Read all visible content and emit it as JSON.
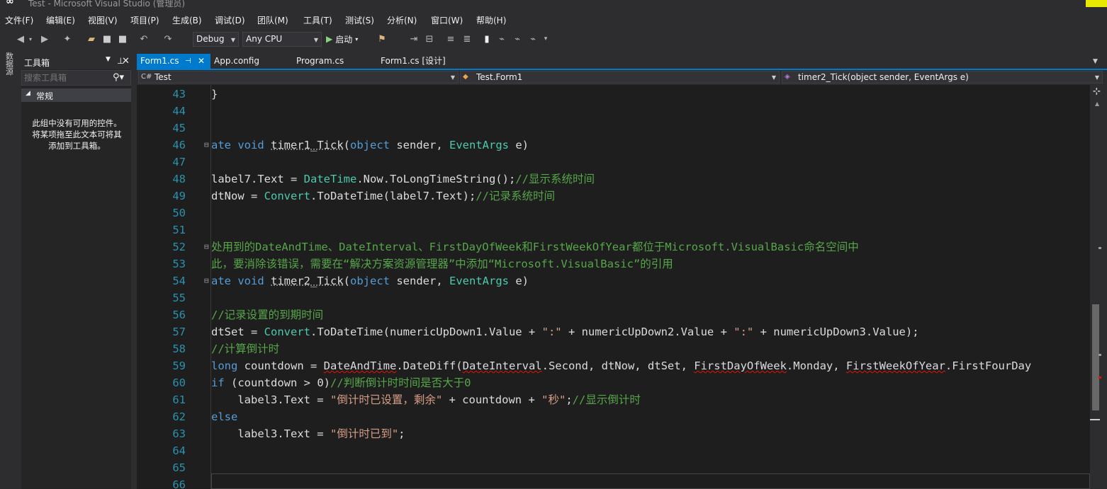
{
  "window": {
    "title": "Test - Microsoft Visual Studio (管理员)"
  },
  "menu": [
    "文件(F)",
    "编辑(E)",
    "视图(V)",
    "项目(P)",
    "生成(B)",
    "调试(D)",
    "团队(M)",
    "工具(T)",
    "测试(S)",
    "分析(N)",
    "窗口(W)",
    "帮助(H)"
  ],
  "toolbar": {
    "config": "Debug",
    "platform": "Any CPU",
    "start_label": "启动"
  },
  "left_strip": {
    "label": "数据源"
  },
  "toolbox": {
    "title": "工具箱",
    "search_placeholder": "搜索工具箱",
    "group": "常规",
    "empty_msg_1": "此组中没有可用的控件。",
    "empty_msg_2": "将某项拖至此文本可将其",
    "empty_msg_3": "添加到工具箱。"
  },
  "tabs": [
    {
      "label": "Form1.cs",
      "active": true
    },
    {
      "label": "App.config"
    },
    {
      "label": "Program.cs"
    },
    {
      "label": "Form1.cs [设计]"
    }
  ],
  "navbar": {
    "project": "Test",
    "class": "Test.Form1",
    "member": "timer2_Tick(object sender, EventArgs e)"
  },
  "code": {
    "lines": [
      "43",
      "44",
      "45",
      "46",
      "47",
      "48",
      "49",
      "50",
      "51",
      "52",
      "53",
      "54",
      "55",
      "56",
      "57",
      "58",
      "59",
      "60",
      "61",
      "62",
      "63",
      "64",
      "65",
      "66"
    ]
  },
  "colors": {
    "accent": "#007acc",
    "keyword": "#569cd6",
    "type": "#4ec9b0",
    "comment": "#57a64a",
    "string": "#d69d85",
    "linenumber": "#2b91af"
  }
}
